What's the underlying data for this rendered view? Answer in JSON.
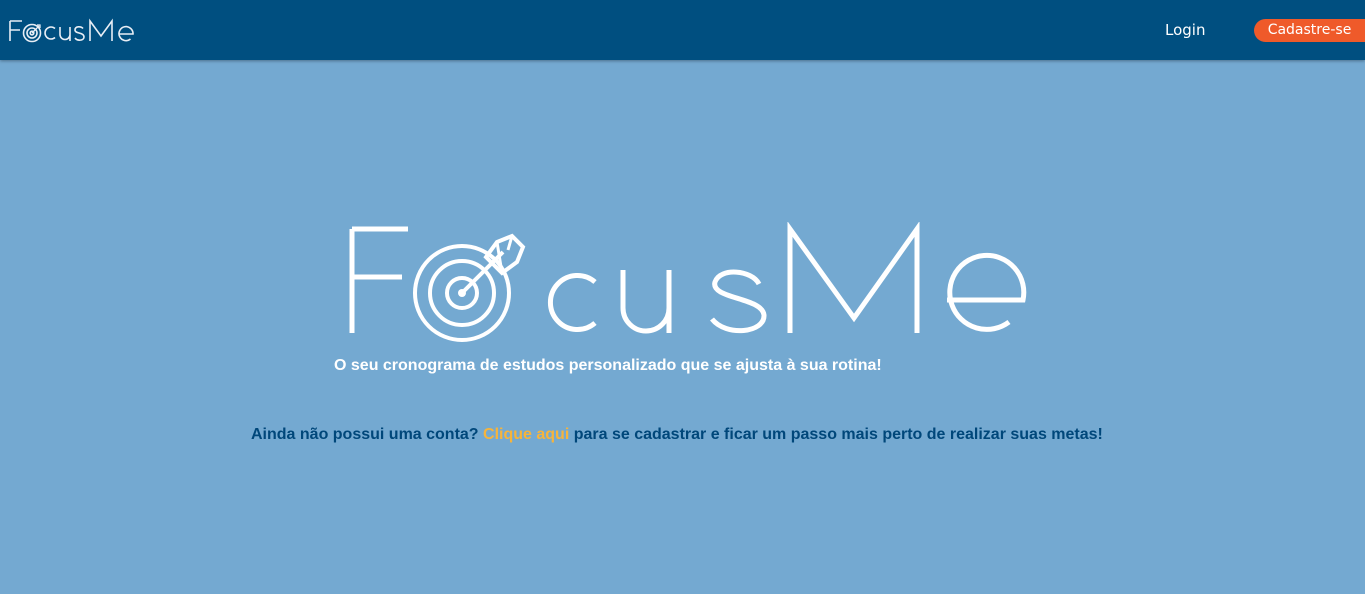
{
  "brand": {
    "name": "FocusMe",
    "logo_color": "#ffffff",
    "accent": "#ef5a2a"
  },
  "nav": {
    "login_label": "Login",
    "signup_label": "Cadastre-se",
    "bg_color": "#004f80"
  },
  "hero": {
    "tagline": "O seu cronograma de estudos personalizado que se ajusta à sua rotina!",
    "cta_prefix": "Ainda não possui uma conta?",
    "cta_link": "Clique aqui",
    "cta_suffix": "para se cadastrar e ficar um passo mais perto de realizar suas metas!"
  },
  "icons": [
    "target-icon",
    "arrow-icon"
  ]
}
